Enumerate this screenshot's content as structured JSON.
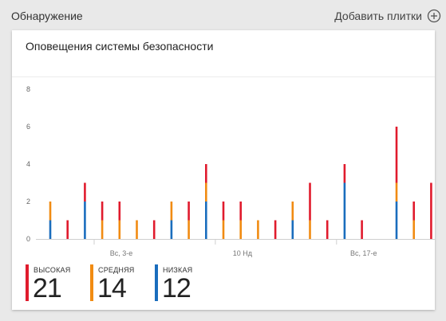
{
  "section": {
    "title": "Обнаружение",
    "add_tiles_label": "Добавить плитки"
  },
  "card": {
    "title": "Оповещения системы безопасности"
  },
  "colors": {
    "high": "#e01b2d",
    "medium": "#f18b12",
    "low": "#1a6dbd"
  },
  "chart_data": {
    "type": "bar",
    "stacked": true,
    "title": "",
    "ylim": [
      0,
      8
    ],
    "y_ticks": [
      "0",
      "2",
      "4",
      "6",
      "8"
    ],
    "x_tick_labels": [
      {
        "label": "Вс, 3-е",
        "index": 4
      },
      {
        "label": "10 Нд",
        "index": 11
      },
      {
        "label": "Вс, 17-е",
        "index": 18
      }
    ],
    "series": [
      {
        "key": "low",
        "values": [
          1,
          0,
          2,
          0,
          0,
          0,
          0,
          1,
          0,
          2,
          0,
          0,
          0,
          0,
          1,
          0,
          0,
          3,
          0,
          0,
          2,
          0,
          0
        ]
      },
      {
        "key": "medium",
        "values": [
          1,
          0,
          0,
          1,
          1,
          1,
          0,
          1,
          1,
          1,
          1,
          1,
          1,
          0,
          1,
          1,
          0,
          0,
          0,
          0,
          1,
          1,
          0
        ]
      },
      {
        "key": "high",
        "values": [
          0,
          1,
          1,
          1,
          1,
          0,
          1,
          0,
          1,
          1,
          1,
          1,
          0,
          1,
          0,
          2,
          1,
          1,
          1,
          0,
          3,
          1,
          3
        ]
      }
    ],
    "grid": false,
    "legend": "bottom"
  },
  "legend": [
    {
      "key": "high",
      "label": "ВЫСОКАЯ",
      "value": "21"
    },
    {
      "key": "medium",
      "label": "СРЕДНЯЯ",
      "value": "14"
    },
    {
      "key": "low",
      "label": "НИЗКАЯ",
      "value": "12"
    }
  ]
}
